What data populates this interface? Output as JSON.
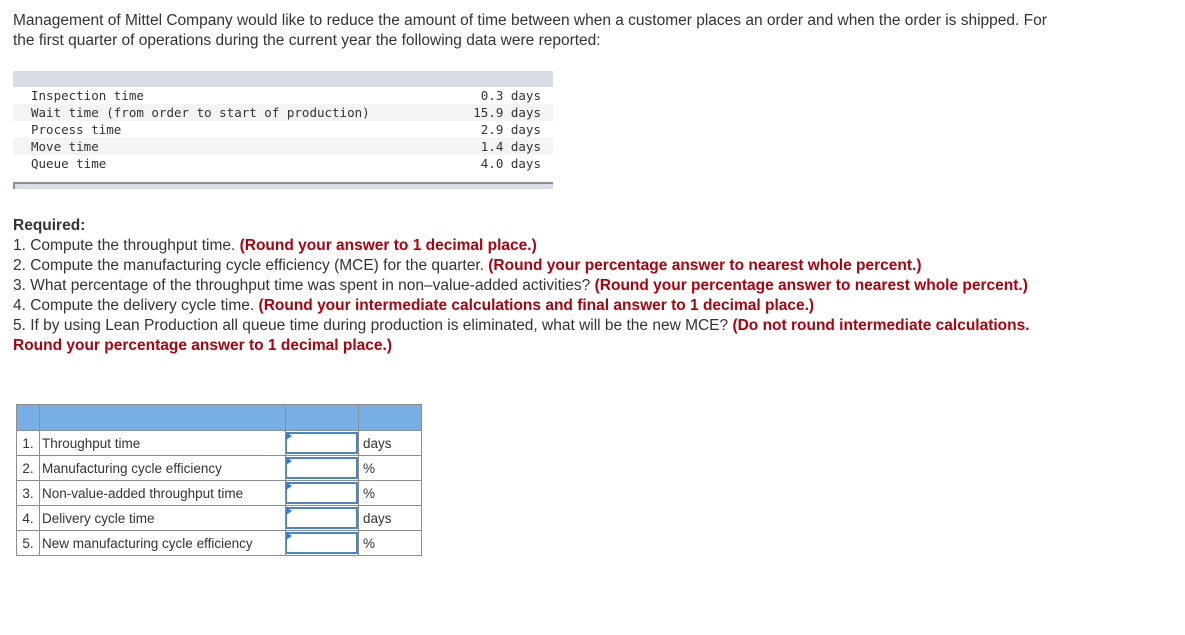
{
  "intro": "Management of Mittel Company would like to reduce the amount of time between when a customer places an order and when the order is shipped. For the first quarter of operations during the current year the following data were reported:",
  "data_rows": [
    {
      "label": "Inspection time",
      "value": "0.3 days"
    },
    {
      "label": "Wait time (from order to start of production)",
      "value": "15.9 days"
    },
    {
      "label": "Process time",
      "value": "2.9 days"
    },
    {
      "label": "Move time",
      "value": "1.4 days"
    },
    {
      "label": "Queue time",
      "value": "4.0 days"
    }
  ],
  "required": {
    "heading": "Required:",
    "items": [
      {
        "text": "1. Compute the throughput time. ",
        "note": "(Round your answer to 1 decimal place.)"
      },
      {
        "text": "2. Compute the manufacturing cycle efficiency (MCE) for the quarter. ",
        "note": "(Round your percentage answer to nearest whole percent.)"
      },
      {
        "text": "3. What percentage of the throughput time was spent in non–value-added activities? ",
        "note": "(Round your percentage answer to nearest whole percent.)"
      },
      {
        "text": "4. Compute the delivery cycle time. ",
        "note": "(Round your intermediate calculations and final answer to 1 decimal place.)"
      },
      {
        "text": "5. If by using Lean Production all queue time during production is eliminated, what will be the new MCE? ",
        "note": "(Do not round intermediate calculations. Round your percentage answer to 1 decimal place.)"
      }
    ]
  },
  "answers": [
    {
      "num": "1.",
      "label": "Throughput time",
      "value": "",
      "unit": "days"
    },
    {
      "num": "2.",
      "label": "Manufacturing cycle efficiency",
      "value": "",
      "unit": "%"
    },
    {
      "num": "3.",
      "label": "Non-value-added throughput time",
      "value": "",
      "unit": "%"
    },
    {
      "num": "4.",
      "label": "Delivery cycle time",
      "value": "",
      "unit": "days"
    },
    {
      "num": "5.",
      "label": "New manufacturing cycle efficiency",
      "value": "",
      "unit": "%"
    }
  ]
}
